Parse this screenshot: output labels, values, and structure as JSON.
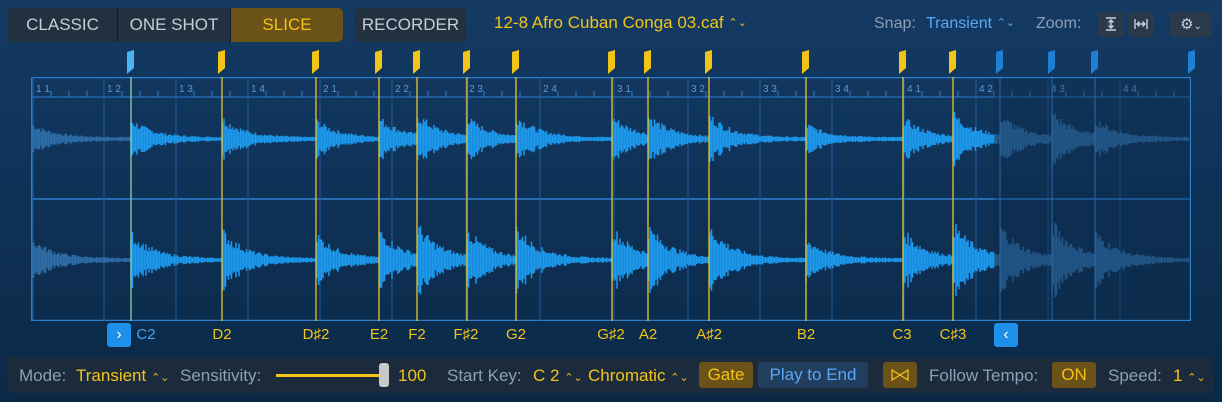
{
  "modes": [
    {
      "label": "CLASSIC",
      "active": false
    },
    {
      "label": "ONE SHOT",
      "active": false
    },
    {
      "label": "SLICE",
      "active": true
    }
  ],
  "recorder_label": "RECORDER",
  "file": {
    "name": "12-8 Afro Cuban Conga 03.caf",
    "chevron": "⌃⌄"
  },
  "snap": {
    "label": "Snap:",
    "value": "Transient"
  },
  "zoom": {
    "label": "Zoom:"
  },
  "icons": {
    "zoom_vertical": "zoom-vertical-icon",
    "zoom_horizontal": "zoom-horizontal-icon",
    "gear": "gear-icon"
  },
  "ruler": [
    "1 1",
    "1 2",
    "1 3",
    "1 4",
    "2 1",
    "2 2",
    "2 3",
    "2 4",
    "3 1",
    "3 2",
    "3 3",
    "3 4",
    "4 1",
    "4 2",
    "4 3",
    "4 4"
  ],
  "slices": [
    {
      "note": "C2",
      "active": true
    },
    {
      "note": "D2"
    },
    {
      "note": "D♯2"
    },
    {
      "note": "E2"
    },
    {
      "note": "F2"
    },
    {
      "note": "F♯2"
    },
    {
      "note": "G2"
    },
    {
      "note": "G♯2"
    },
    {
      "note": "A2"
    },
    {
      "note": "A♯2"
    },
    {
      "note": "B2"
    },
    {
      "note": "C3"
    },
    {
      "note": "C♯3"
    }
  ],
  "bottom": {
    "mode_label": "Mode:",
    "mode_value": "Transient",
    "sensitivity_label": "Sensitivity:",
    "sensitivity_value": "100",
    "sensitivity_level": 1.0,
    "start_key_label": "Start Key:",
    "start_key_value": "C 2",
    "scale_value": "Chromatic",
    "gate_label": "Gate",
    "play_to_end_label": "Play to End",
    "follow_tempo_label": "Follow Tempo:",
    "follow_tempo_value": "ON",
    "speed_label": "Speed:",
    "speed_value": "1"
  },
  "colors": {
    "accent_yellow": "#f2c418",
    "accent_blue": "#5aa7f3",
    "waveform": "#1d9bf0"
  }
}
